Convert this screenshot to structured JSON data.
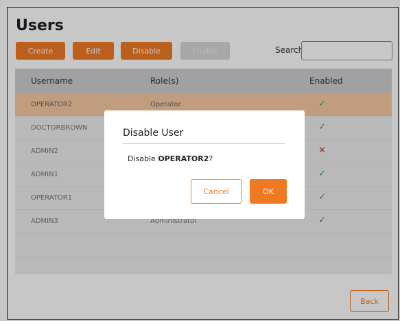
{
  "page": {
    "title": "Users"
  },
  "toolbar": {
    "create_label": "Create",
    "edit_label": "Edit",
    "disable_label": "Disable",
    "enable_label": "Enable",
    "search_label": "Search:",
    "search_value": ""
  },
  "table": {
    "columns": [
      "Username",
      "Role(s)",
      "Enabled"
    ],
    "rows": [
      {
        "username": "OPERATOR2",
        "role": "Operator",
        "enabled": "✓"
      },
      {
        "username": "DOCTORBROWN",
        "role": "",
        "enabled": "✓"
      },
      {
        "username": "ADMIN2",
        "role": "",
        "enabled": "✕"
      },
      {
        "username": "ADMIN1",
        "role": "",
        "enabled": "✓"
      },
      {
        "username": "OPERATOR1",
        "role": "",
        "enabled": "✓"
      },
      {
        "username": "ADMIN3",
        "role": "Administrator",
        "enabled": "✓"
      }
    ]
  },
  "dialog": {
    "title": "Disable User",
    "message_prefix": "Disable ",
    "message_user": "OPERATOR2",
    "message_suffix": "?",
    "cancel_label": "Cancel",
    "ok_label": "OK"
  },
  "footer": {
    "back_label": "Back"
  },
  "colors": {
    "accent": "#f07a24",
    "selected_row": "#f6c9a2",
    "enabled": "#3a9a4a",
    "disabled": "#d33434"
  }
}
